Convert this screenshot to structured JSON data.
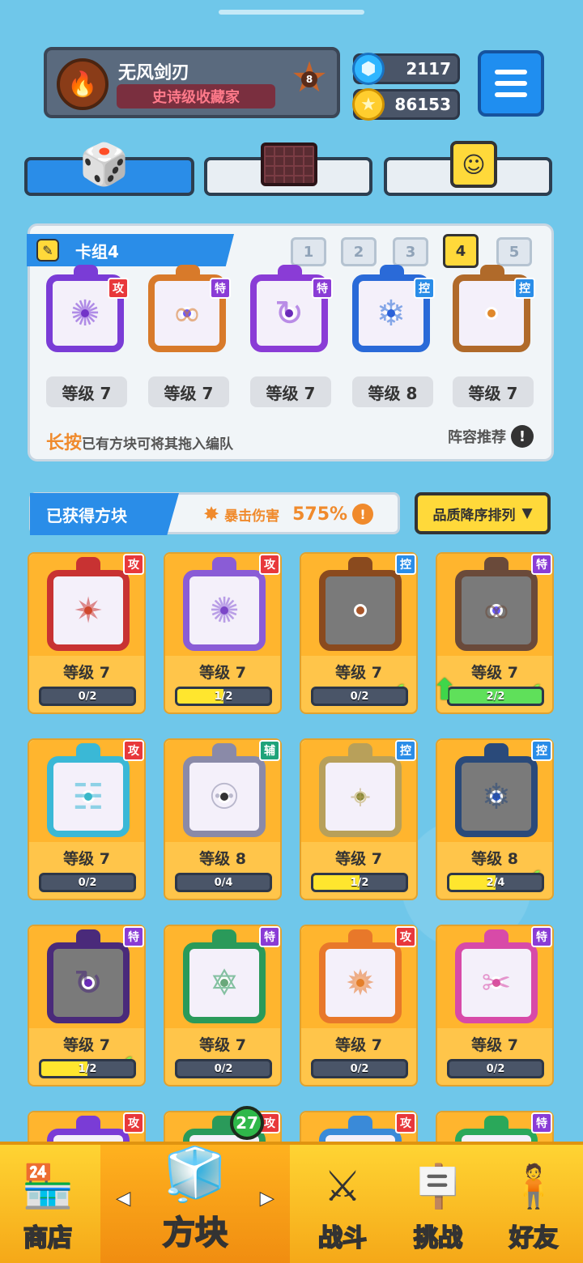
{
  "player": {
    "name": "无风剑刃",
    "title": "史诗级收藏家",
    "rank": "8"
  },
  "currency": {
    "gems": "2117",
    "coins": "86153"
  },
  "icons": {
    "menu": "hamburger-menu-icon",
    "gem": "gem-icon",
    "coin": "coin-icon",
    "avatar": "fire-emblem-icon"
  },
  "tabs": [
    {
      "name": "dice-tab",
      "icon": "dice-icon",
      "active": true
    },
    {
      "name": "board-tab",
      "icon": "board-icon",
      "active": false
    },
    {
      "name": "emote-tab",
      "icon": "smile-cube-icon",
      "active": false
    }
  ],
  "deck": {
    "title": "卡组4",
    "slots": [
      "1",
      "2",
      "3",
      "4",
      "5"
    ],
    "active_slot": "4",
    "cards": [
      {
        "tag": "攻",
        "tagType": "atk",
        "level": "等级 7",
        "color": "#7a3cd6",
        "dot": "#6a2cb8",
        "glyph": "✺"
      },
      {
        "tag": "特",
        "tagType": "spc",
        "level": "等级 7",
        "color": "#d87a2a",
        "dot": "#6a5cff",
        "glyph": "∞"
      },
      {
        "tag": "特",
        "tagType": "spc",
        "level": "等级 7",
        "color": "#8a3cd6",
        "dot": "#6a2cb8",
        "glyph": "↻"
      },
      {
        "tag": "控",
        "tagType": "ctl",
        "level": "等级 8",
        "color": "#2a6ad8",
        "dot": "#2a5ad8",
        "glyph": "❄"
      },
      {
        "tag": "控",
        "tagType": "ctl",
        "level": "等级 7",
        "color": "#b06a2a",
        "dot": "#e0882a",
        "glyph": ""
      }
    ],
    "hint_highlight": "长按",
    "hint_text": "已有方块可将其拖入编队",
    "recommend": "阵容推荐",
    "recommend_icon": "!"
  },
  "obtained": {
    "title": "已获得方块",
    "crit_label": "暴击伤害",
    "crit_value": "575%",
    "info_icon": "!",
    "sort_label": "品质降序排列",
    "sort_arrow": "▼"
  },
  "grid": [
    {
      "tag": "攻",
      "tagType": "atk",
      "level": "等级 7",
      "progress": "0/2",
      "fill": 0,
      "color": "#c83232",
      "dot": "#d8642a",
      "glyph": "✷",
      "check": false
    },
    {
      "tag": "攻",
      "tagType": "atk",
      "level": "等级 7",
      "progress": "1/2",
      "fill": 0.5,
      "color": "#8a5cd6",
      "dot": "#6a2cb8",
      "glyph": "✺",
      "check": false
    },
    {
      "tag": "控",
      "tagType": "ctl",
      "level": "等级 7",
      "progress": "0/2",
      "fill": 0,
      "color": "#8a4a1e",
      "dot": "#a8562a",
      "glyph": "",
      "check": true
    },
    {
      "tag": "特",
      "tagType": "spc",
      "level": "等级 7",
      "progress": "2/2",
      "fill": 1,
      "color": "#6a4a3a",
      "dot": "#6a5cff",
      "glyph": "∞",
      "check": true,
      "upgrade": true
    },
    {
      "tag": "攻",
      "tagType": "atk",
      "level": "等级 7",
      "progress": "0/2",
      "fill": 0,
      "color": "#3ab8d6",
      "dot": "#3ab8c8",
      "glyph": "☷",
      "check": false
    },
    {
      "tag": "辅",
      "tagType": "sup",
      "level": "等级 8",
      "progress": "0/4",
      "fill": 0,
      "color": "#8a8aa8",
      "dot": "#333333",
      "glyph": "⚇",
      "check": false
    },
    {
      "tag": "控",
      "tagType": "ctl",
      "level": "等级 7",
      "progress": "1/2",
      "fill": 0.5,
      "color": "#b8a05a",
      "dot": "#8a8a3a",
      "glyph": "⌖",
      "check": false
    },
    {
      "tag": "控",
      "tagType": "ctl",
      "level": "等级 8",
      "progress": "2/4",
      "fill": 0.5,
      "color": "#2a4a7a",
      "dot": "#2a5ad8",
      "glyph": "❄",
      "check": true
    },
    {
      "tag": "特",
      "tagType": "spc",
      "level": "等级 7",
      "progress": "1/2",
      "fill": 0.5,
      "color": "#4a2a7a",
      "dot": "#6a2cb8",
      "glyph": "↻",
      "check": true
    },
    {
      "tag": "特",
      "tagType": "spc",
      "level": "等级 7",
      "progress": "0/2",
      "fill": 0,
      "color": "#2a9a5a",
      "dot": "#6aa87a",
      "glyph": "✡",
      "check": false
    },
    {
      "tag": "攻",
      "tagType": "atk",
      "level": "等级 7",
      "progress": "0/2",
      "fill": 0,
      "color": "#e8782a",
      "dot": "#e0882a",
      "glyph": "✹",
      "check": false
    },
    {
      "tag": "特",
      "tagType": "spc",
      "level": "等级 7",
      "progress": "0/2",
      "fill": 0,
      "color": "#d84aa8",
      "dot": "#d85a9a",
      "glyph": "✂",
      "check": false
    },
    {
      "tag": "攻",
      "tagType": "atk",
      "color": "#7a3cd6"
    },
    {
      "tag": "攻",
      "tagType": "atk",
      "color": "#2a9a5a"
    },
    {
      "tag": "攻",
      "tagType": "atk",
      "color": "#3a8ad8"
    },
    {
      "tag": "特",
      "tagType": "spc",
      "color": "#2aa85a"
    }
  ],
  "nav": {
    "shop": "商店",
    "blocks": "方块",
    "battle": "战斗",
    "challenge": "挑战",
    "friends": "好友",
    "blocks_badge": "27",
    "left_arrow": "◀",
    "right_arrow": "▶"
  }
}
